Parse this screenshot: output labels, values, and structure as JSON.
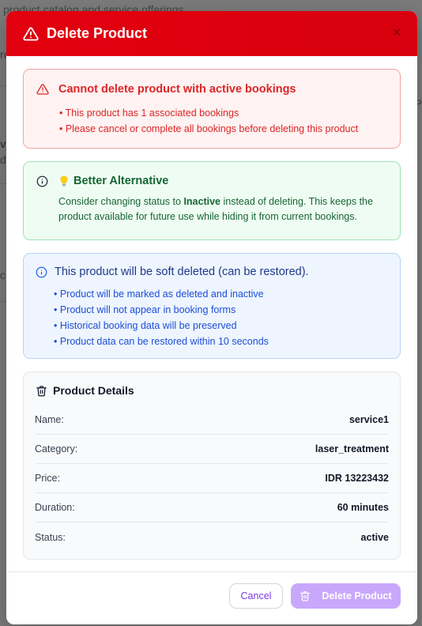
{
  "background": {
    "top_text": "product catalog and service offerings",
    "left_fragments": [
      "ro",
      "vi",
      "d",
      "c"
    ],
    "right_fragment": "P"
  },
  "modal": {
    "title": "Delete Product",
    "close_label": "×",
    "error": {
      "title": "Cannot delete product with active bookings",
      "items": [
        "• This product has 1 associated bookings",
        "• Please cancel or complete all bookings before deleting this product"
      ]
    },
    "alternative": {
      "title": "Better Alternative",
      "text_before": "Consider changing status to ",
      "text_bold": "Inactive",
      "text_after": " instead of deleting. This keeps the product available for future use while hiding it from current bookings."
    },
    "soft_delete": {
      "title": "This product will be soft deleted (can be restored).",
      "items": [
        "• Product will be marked as deleted and inactive",
        "• Product will not appear in booking forms",
        "• Historical booking data will be preserved",
        "• Product data can be restored within 10 seconds"
      ]
    },
    "details": {
      "title": "Product Details",
      "rows": [
        {
          "label": "Name:",
          "value": "service1"
        },
        {
          "label": "Category:",
          "value": "laser_treatment"
        },
        {
          "label": "Price:",
          "value": "IDR 13223432"
        },
        {
          "label": "Duration:",
          "value": "60 minutes"
        },
        {
          "label": "Status:",
          "value": "active"
        }
      ]
    },
    "footer": {
      "cancel_label": "Cancel",
      "delete_label": "Delete Product"
    }
  },
  "colors": {
    "header_red": "#e3000f",
    "error_red": "#dc2626",
    "success_green": "#166534",
    "info_blue": "#1d4ed8",
    "accent_purple": "#7c3aed",
    "disabled_purple": "#c9a8fb"
  }
}
